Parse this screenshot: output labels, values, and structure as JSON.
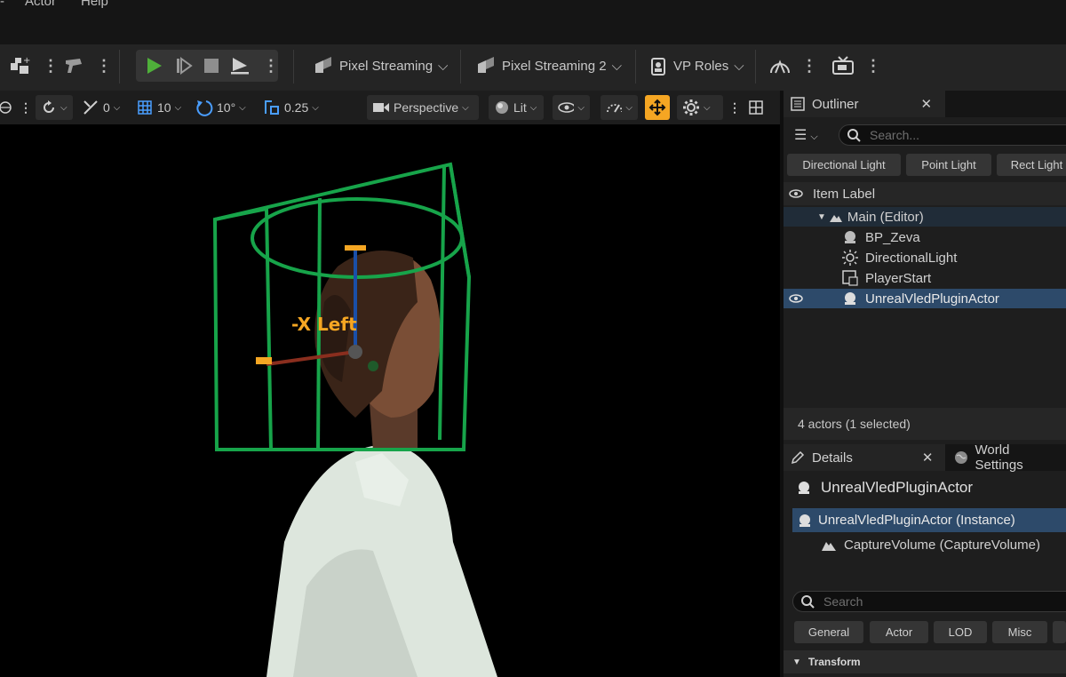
{
  "menu": {
    "actor": "Actor",
    "help": "Help"
  },
  "toolbar": {
    "pixel_streaming": "Pixel Streaming",
    "pixel_streaming_2": "Pixel Streaming 2",
    "vp_roles": "VP Roles"
  },
  "viewport_toolbar": {
    "translate_snap": "0",
    "grid_snap": "10",
    "rotation_snap": "10°",
    "scale_snap": "0.25",
    "view_mode": "Perspective",
    "lighting": "Lit"
  },
  "viewport": {
    "gizmo_label": "-X Left"
  },
  "outliner": {
    "tab": "Outliner",
    "search_placeholder": "Search...",
    "chips": [
      "Directional Light",
      "Point Light",
      "Rect Light"
    ],
    "column": "Item Label",
    "root": "Main (Editor)",
    "items": [
      "BP_Zeva",
      "DirectionalLight",
      "PlayerStart",
      "UnrealVledPluginActor"
    ],
    "status": "4 actors (1 selected)"
  },
  "details": {
    "tab": "Details",
    "world_tab": "World Settings",
    "actor_name": "UnrealVledPluginActor",
    "instance": "UnrealVledPluginActor (Instance)",
    "component": "CaptureVolume (CaptureVolume)",
    "search_placeholder": "Search",
    "chips": [
      "General",
      "Actor",
      "LOD",
      "Misc"
    ],
    "section": "Transform"
  },
  "colors": {
    "accent_orange": "#f5a623",
    "play_green": "#4fb03a",
    "selection_blue": "#2d4a6a",
    "capture_volume_green": "#17a44a"
  }
}
